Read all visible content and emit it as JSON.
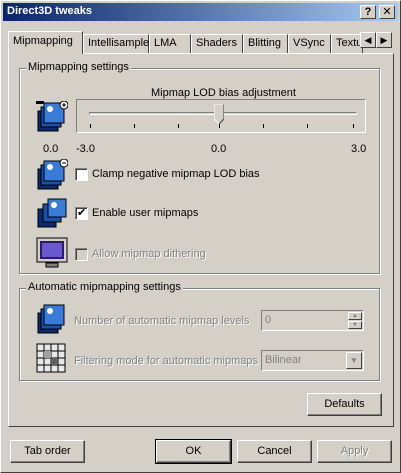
{
  "window": {
    "title": "Direct3D tweaks"
  },
  "titlebar_buttons": {
    "help": "?",
    "close": "✕"
  },
  "tabs": [
    "Mipmapping",
    "Intellisample",
    "LMA",
    "Shaders",
    "Blitting",
    "VSync",
    "Textu"
  ],
  "tab_scroll": {
    "left": "◀",
    "right": "▶"
  },
  "mipmapping_group": {
    "title": "Mipmapping settings",
    "slider": {
      "label": "Mipmap LOD bias adjustment",
      "current_value_label": "0.0",
      "min_label": "-3.0",
      "mid_label": "0.0",
      "max_label": "3.0",
      "min": -3.0,
      "max": 3.0,
      "value": 0.0
    },
    "clamp_checkbox": {
      "label": "Clamp negative mipmap LOD bias",
      "checked": false
    },
    "user_mipmaps_checkbox": {
      "label": "Enable user mipmaps",
      "checked": true,
      "mark": "✔"
    },
    "dithering_checkbox": {
      "label": "Allow mipmap dithering",
      "checked": false,
      "disabled": true
    }
  },
  "auto_group": {
    "title": "Automatic mipmapping settings",
    "levels": {
      "label": "Number of automatic mipmap levels",
      "value": "0",
      "up": "▲",
      "down": "▼"
    },
    "filtering": {
      "label": "Filtering mode for automatic mipmaps",
      "value": "Bilinear",
      "arrow": "▼"
    }
  },
  "defaults_button": "Defaults",
  "footer": {
    "tab_order": "Tab order",
    "ok": "OK",
    "cancel": "Cancel",
    "apply": "Apply"
  }
}
